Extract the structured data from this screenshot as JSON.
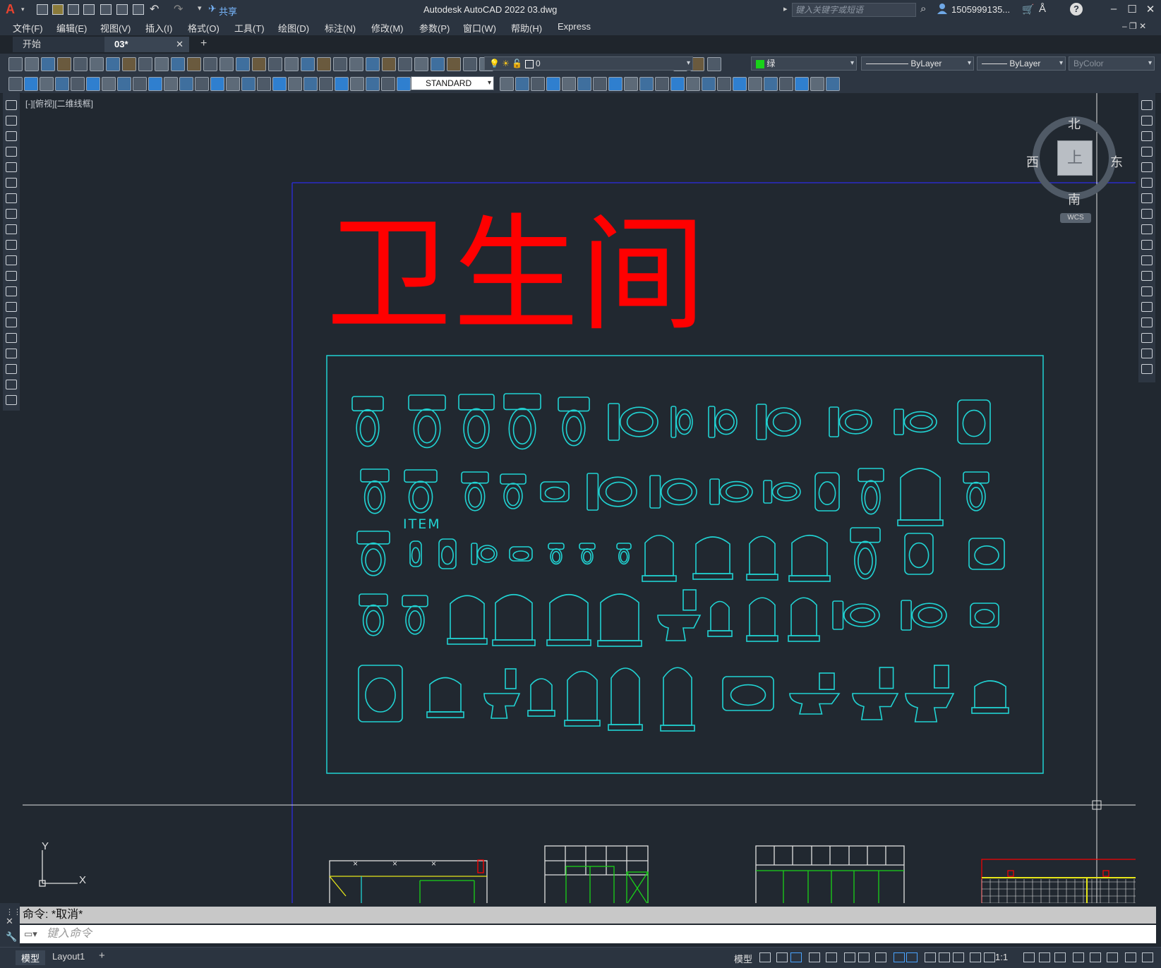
{
  "app": {
    "logo": "A",
    "title": "Autodesk AutoCAD 2022    03.dwg",
    "share_label": "共享",
    "search_placeholder": "键入关键字或短语",
    "user": "1505999135...",
    "help": "?"
  },
  "menu": [
    "文件(F)",
    "编辑(E)",
    "视图(V)",
    "插入(I)",
    "格式(O)",
    "工具(T)",
    "绘图(D)",
    "标注(N)",
    "修改(M)",
    "参数(P)",
    "窗口(W)",
    "帮助(H)",
    "Express"
  ],
  "tabs": [
    {
      "label": "开始"
    },
    {
      "label": "03*"
    }
  ],
  "toolbar": {
    "layer_value": "0",
    "color_value": "绿",
    "linetype_value": "ByLayer",
    "lineweight_value": "ByLayer",
    "plotstyle_value": "ByColor",
    "textstyle_value": "STANDARD"
  },
  "viewport": {
    "label": "[-][俯视][二维线框]"
  },
  "viewcube": {
    "north": "北",
    "south": "南",
    "east": "东",
    "west": "西",
    "top": "上",
    "wcs": "WCS"
  },
  "drawing": {
    "title": "卫生间",
    "item_label": "ITEM",
    "ucs_y": "Y",
    "ucs_x": "X"
  },
  "command": {
    "history": "命令: *取消*",
    "placeholder": "键入命令"
  },
  "status": {
    "model_tab": "模型",
    "layout_tab": "Layout1",
    "model_btn": "模型",
    "scale": "1:1"
  },
  "colors": {
    "cad_cyan": "#21d3d3",
    "cad_red": "#ff0000",
    "cad_green": "#19d219",
    "cad_yellow": "#e6e619",
    "canvas_bg": "#212830"
  }
}
